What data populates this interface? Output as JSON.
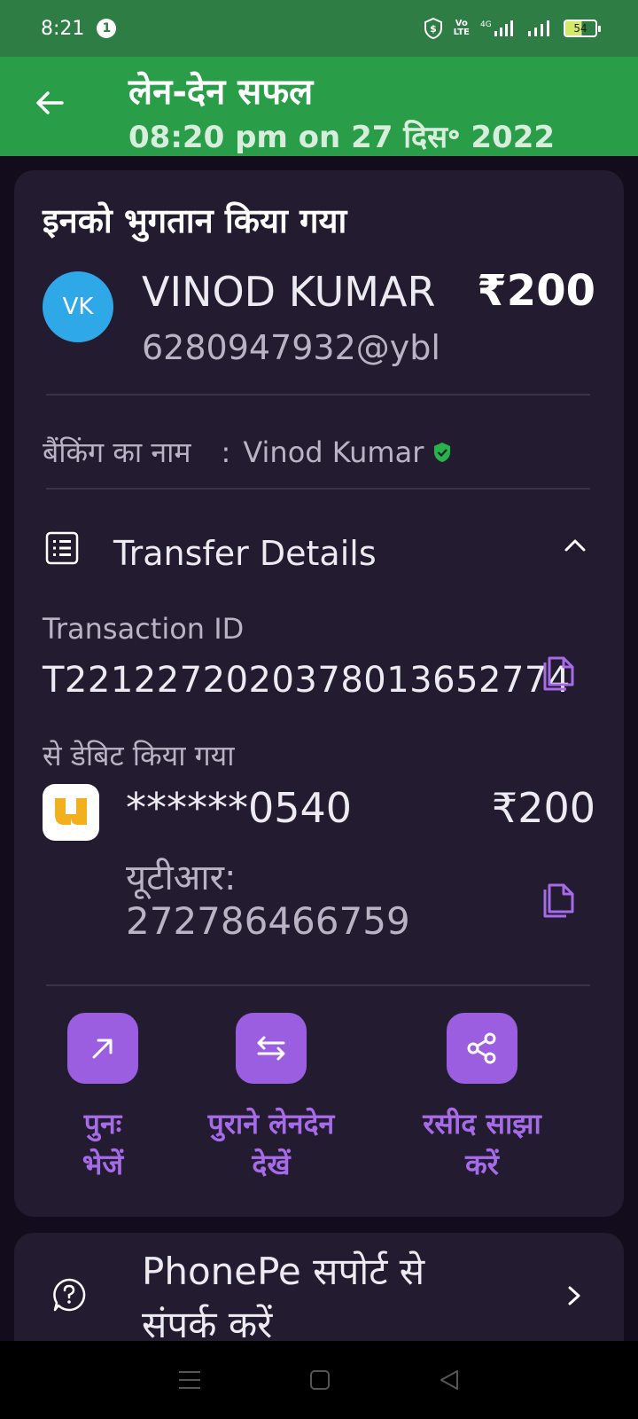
{
  "status_bar": {
    "time": "8:21",
    "notification_count": "1",
    "network": "4G",
    "volte": "VoLTE",
    "battery": "54"
  },
  "header": {
    "title": "लेन-देन सफल",
    "subtitle": "08:20 pm on 27 दिस॰ 2022"
  },
  "payment": {
    "section_title": "इनको भुगतान किया गया",
    "avatar_initials": "VK",
    "payee_name": "VINOD KUMAR",
    "amount": "₹200",
    "upi_id": "6280947932@ybl",
    "banking_name_label": "बैंकिंग का नाम",
    "banking_name_sep": ":",
    "banking_name": "Vinod Kumar"
  },
  "transfer_details": {
    "title": "Transfer Details",
    "transaction_id_label": "Transaction ID",
    "transaction_id": "T2212272020378013652774",
    "debited_from_label": "से डेबिट किया गया",
    "account_masked": "******0540",
    "account_amount": "₹200",
    "utr_label": "यूटीआर:",
    "utr_value": "272786466759"
  },
  "actions": [
    {
      "label_line1": "पुनः",
      "label_line2": "भेजें",
      "icon": "arrow-up-right-icon"
    },
    {
      "label_line1": "पुराने लेनदेन",
      "label_line2": "देखें",
      "icon": "swap-arrows-icon"
    },
    {
      "label_line1": "रसीद साझा",
      "label_line2": "करें",
      "icon": "share-icon"
    }
  ],
  "support": {
    "line1": "PhonePe सपोर्ट से",
    "line2": "संपर्क करें"
  },
  "colors": {
    "header_green": "#2a9d48",
    "accent_purple": "#9b5ee0",
    "card_bg": "#231b2f",
    "avatar_blue": "#2fa8e8"
  }
}
